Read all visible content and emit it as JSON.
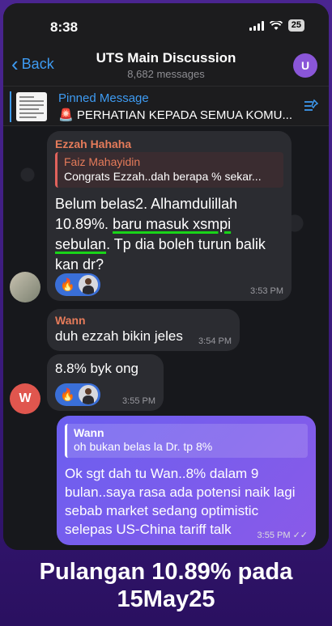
{
  "status_bar": {
    "time": "8:38",
    "battery": "25"
  },
  "header": {
    "back_label": "Back",
    "title": "UTS Main Discussion",
    "subtitle": "8,682 messages",
    "avatar_letter": "U"
  },
  "pinned": {
    "label": "Pinned Message",
    "text": "🚨 PERHATIAN KEPADA SEMUA KOMU..."
  },
  "messages": [
    {
      "sender": "Ezzah Hahaha",
      "reply_to": {
        "sender": "Faiz Mahayidin",
        "text": "Congrats Ezzah..dah berapa % sekar..."
      },
      "text_before": "Belum belas2. Alhamdulillah 10.89%. ",
      "text_highlight": "baru masuk xsmpi sebulan",
      "text_after": ". Tp dia boleh turun balik kan dr?",
      "reaction_emoji": "🔥",
      "time": "3:53 PM"
    },
    {
      "sender": "Wann",
      "text": "duh ezzah bikin jeles",
      "time": "3:54 PM"
    },
    {
      "text": "8.8% byk ong",
      "reaction_emoji": "🔥",
      "time": "3:55 PM",
      "avatar_letter": "W"
    },
    {
      "reply_to": {
        "sender": "Wann",
        "text": "oh bukan belas la Dr. tp 8%"
      },
      "text": "Ok sgt dah tu Wan..8% dalam 9 bulan..saya rasa ada potensi naik lagi sebab market sedang optimistic selepas US-China tariff talk",
      "time": "3:55 PM"
    }
  ],
  "caption": {
    "line1": "Pulangan 10.89% pada",
    "line2": "15May25"
  },
  "colors": {
    "accent": "#3e9bf2",
    "own_bubble": "#7b5cf0",
    "highlight_underline": "#19d419",
    "reply_bar": "#e0625c"
  }
}
